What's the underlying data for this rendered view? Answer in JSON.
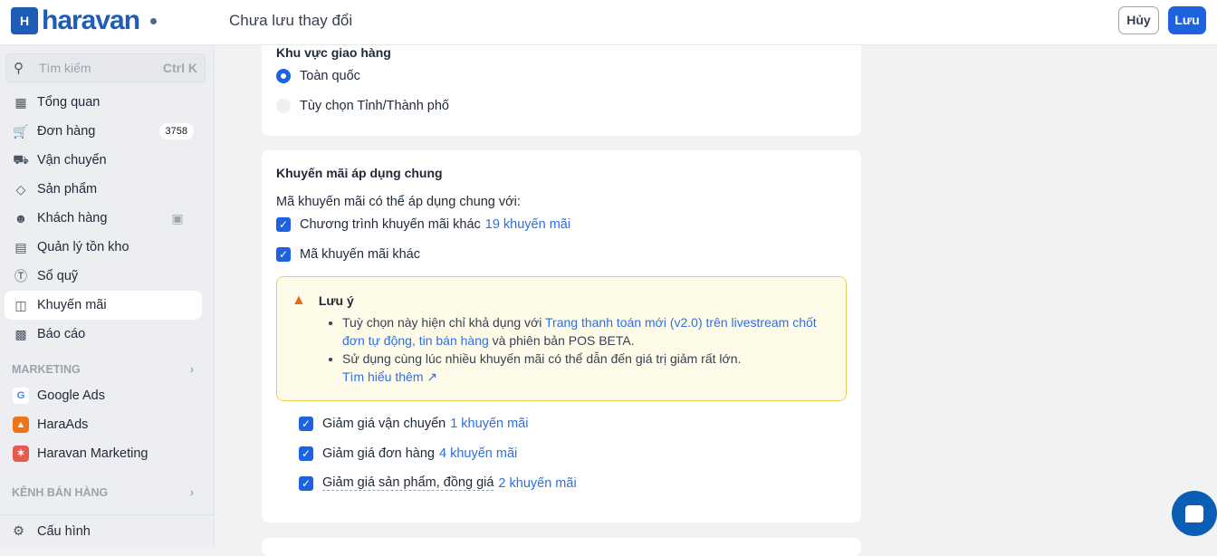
{
  "header": {
    "logo": "haravan",
    "title": "Chưa lưu thay đổi",
    "cancel": "Hủy",
    "save": "Lưu"
  },
  "sidebar": {
    "search_placeholder": "Tìm kiếm",
    "search_shortcut": "Ctrl K",
    "items": [
      {
        "label": "Tổng quan",
        "icon": "dashboard-icon"
      },
      {
        "label": "Đơn hàng",
        "icon": "cart-icon",
        "badge": "3758"
      },
      {
        "label": "Vận chuyển",
        "icon": "truck-icon"
      },
      {
        "label": "Sản phẩm",
        "icon": "tag-icon"
      },
      {
        "label": "Khách hàng",
        "icon": "users-icon"
      },
      {
        "label": "Quản lý tồn kho",
        "icon": "inventory-icon"
      },
      {
        "label": "Sổ quỹ",
        "icon": "dollar-icon"
      },
      {
        "label": "Khuyến mãi",
        "icon": "gift-icon"
      },
      {
        "label": "Báo cáo",
        "icon": "chart-icon"
      }
    ],
    "marketing_title": "MARKETING",
    "marketing": [
      {
        "label": "Google Ads"
      },
      {
        "label": "HaraAds"
      },
      {
        "label": "Haravan Marketing"
      }
    ],
    "sales_channel_title": "KÊNH BÁN HÀNG",
    "settings": "Cấu hình"
  },
  "shipping": {
    "title": "Khu vực giao hàng",
    "options": [
      "Toàn quốc",
      "Tùy chọn Tỉnh/Thành phố"
    ]
  },
  "promo": {
    "title": "Khuyến mãi áp dụng chung",
    "desc": "Mã khuyến mãi có thể áp dụng chung với:",
    "opt1": "Chương trình khuyến mãi khác",
    "opt1_link": "19 khuyến mãi",
    "opt2": "Mã khuyến mãi khác",
    "note": {
      "title": "Lưu ý",
      "b1_pre": "Tuỳ chọn này hiện chỉ khả dụng với ",
      "b1_link": "Trang thanh toán mới (v2.0) trên livestream chốt đơn tự động, tin bán hàng",
      "b1_post": " và phiên bản POS BETA.",
      "b2": "Sử dụng cùng lúc nhiều khuyến mãi có thể dẫn đến giá trị giảm rất lớn.",
      "learn_more": "Tìm hiểu thêm"
    },
    "subs": [
      {
        "label": "Giảm giá vận chuyển",
        "link": "1 khuyến mãi"
      },
      {
        "label": "Giảm giá đơn hàng",
        "link": "4 khuyến mãi"
      },
      {
        "label": "Giảm giá sản phẩm, đồng giá",
        "link": "2 khuyến mãi"
      }
    ]
  }
}
